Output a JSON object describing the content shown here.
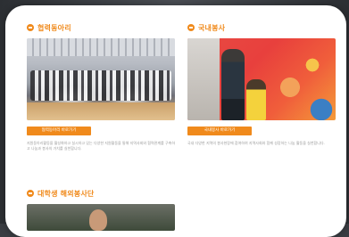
{
  "sections": [
    {
      "title": "협력동아리",
      "button_label": "협력동아리 바로가기",
      "description": "지원동아리활동을 활성화하고 실시하고 있는 다양한 지원활동을 통해 지역사회와 협력관계를 구축하고 나눔과 봉사의 가치를 실천합니다."
    },
    {
      "title": "국내봉사",
      "button_label": "국내봉사 바로가기",
      "description": "국내 다양한 지역의 봉사현장에 참여하여 지역사회와 함께 성장하는 나눔 활동을 실천합니다."
    },
    {
      "title": "대학생 해외봉사단"
    }
  ],
  "colors": {
    "accent": "#f08a1c",
    "text_muted": "#9a9a9a",
    "card_bg": "#ffffff"
  },
  "icons": {
    "section_bullet": "orange-circle-bullet-icon"
  }
}
